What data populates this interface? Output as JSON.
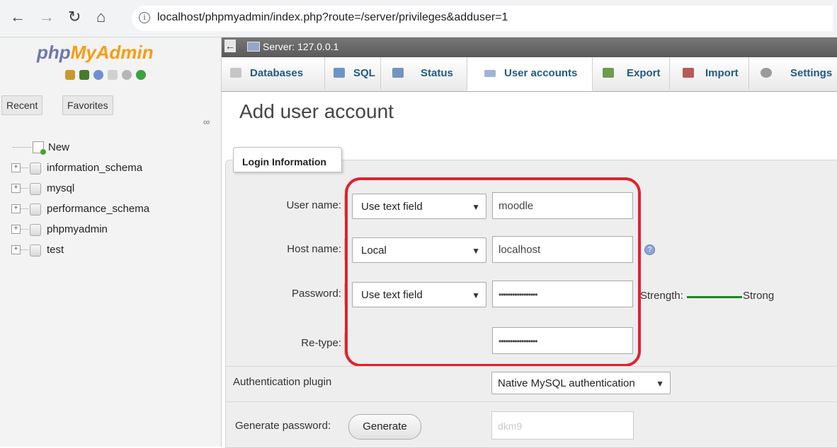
{
  "browser": {
    "back_icon": "arrow-left-icon",
    "forward_icon": "arrow-right-icon",
    "reload_icon": "reload-icon",
    "home_icon": "home-icon",
    "url": "localhost/phpmyadmin/index.php?route=/server/privileges&adduser=1"
  },
  "sidebar": {
    "logo_part1": "php",
    "logo_part2": "MyAdmin",
    "recent_label": "Recent",
    "favorites_label": "Favorites",
    "tree": [
      {
        "label": "New"
      },
      {
        "label": "information_schema"
      },
      {
        "label": "mysql"
      },
      {
        "label": "performance_schema"
      },
      {
        "label": "phpmyadmin"
      },
      {
        "label": "test"
      }
    ]
  },
  "serverbar": {
    "label": "Server: 127.0.0.1"
  },
  "tabs": [
    {
      "label": "Databases",
      "icon": "database-icon"
    },
    {
      "label": "SQL",
      "icon": "sql-icon"
    },
    {
      "label": "Status",
      "icon": "status-icon"
    },
    {
      "label": "User accounts",
      "icon": "user-accounts-icon",
      "active": true
    },
    {
      "label": "Export",
      "icon": "export-icon"
    },
    {
      "label": "Import",
      "icon": "import-icon"
    },
    {
      "label": "Settings",
      "icon": "settings-icon"
    }
  ],
  "main": {
    "title": "Add user account",
    "legend": "Login Information",
    "username": {
      "label": "User name:",
      "type": "Use text field",
      "value": "moodle"
    },
    "hostname": {
      "label": "Host name:",
      "type": "Local",
      "value": "localhost"
    },
    "password": {
      "label": "Password:",
      "type": "Use text field",
      "value": "•••••••••••••••••",
      "strength_label": "Strength:",
      "strength_value": "Strong"
    },
    "retype": {
      "label": "Re-type:",
      "value": "•••••••••••••••••"
    },
    "auth_plugin": {
      "label": "Authentication plugin",
      "value": "Native MySQL authentication"
    },
    "generate": {
      "label": "Generate password:",
      "button": "Generate",
      "value": "dkm9"
    }
  },
  "colors": {
    "highlight": "#e3202a",
    "strength": "#1b8a1b",
    "link": "#235a81"
  }
}
